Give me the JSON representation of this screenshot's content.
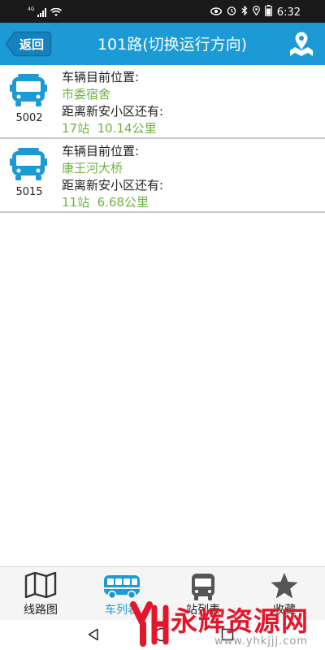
{
  "status_bar": {
    "network_label": "4G",
    "time": "6:32",
    "icons": [
      "signal-icon",
      "wifi-icon",
      "eye-icon",
      "alarm-icon",
      "bluetooth-icon",
      "location-icon",
      "battery-icon"
    ]
  },
  "header": {
    "back_label": "返回",
    "title": "101路(切换运行方向)",
    "map_icon": "map-pin-icon",
    "color": "#1b9ad6"
  },
  "buses": [
    {
      "number": "5002",
      "position_label": "车辆目前位置:",
      "position": "市委宿舍",
      "distance_label": "距离新安小区还有:",
      "stops": "17站",
      "distance": "10.14公里"
    },
    {
      "number": "5015",
      "position_label": "车辆目前位置:",
      "position": "康王河大桥",
      "distance_label": "距离新安小区还有:",
      "stops": "11站",
      "distance": "6.68公里"
    }
  ],
  "bottom_nav": [
    {
      "label": "线路图",
      "icon": "map-icon",
      "active": false
    },
    {
      "label": "车列表",
      "icon": "bus-icon",
      "active": true
    },
    {
      "label": "站列表",
      "icon": "bus-front-icon",
      "active": false
    },
    {
      "label": "收藏",
      "icon": "star-icon",
      "active": false
    }
  ],
  "watermark": {
    "title": "永辉资源网",
    "url": "www.yhkjjj.com"
  },
  "colors": {
    "accent": "#1b9ad6",
    "value_green": "#6db33f",
    "watermark_red": "#e4162b"
  }
}
